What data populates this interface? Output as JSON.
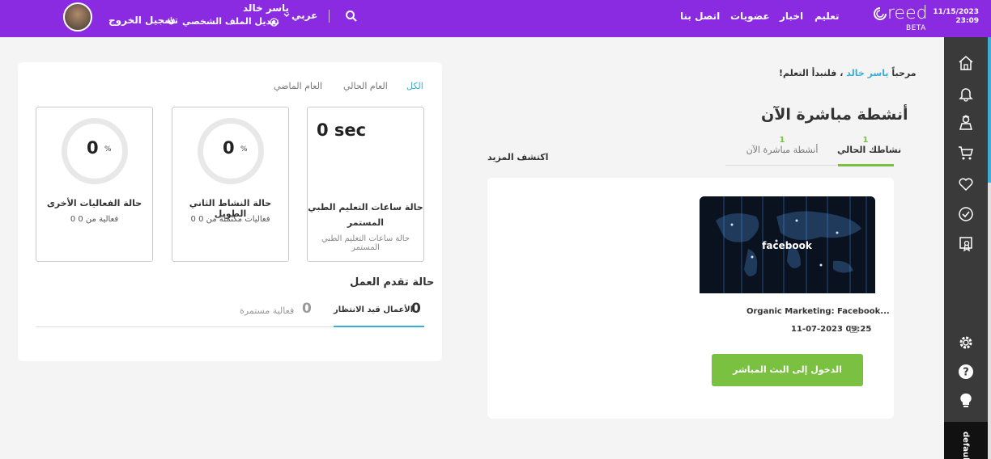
{
  "header": {
    "date": "11/15/2023",
    "time": "23:09",
    "logo_text": "reed",
    "logo_beta": "BETA",
    "nav": [
      "تعليم",
      "اخبار",
      "عضويات",
      "اتصل بنا"
    ],
    "language": "عربي",
    "user_name": "ياسر خالد",
    "edit_profile": "تعديل الملف الشخصي",
    "logout": "تسجيل الخروج",
    "thumbnail_brand": "facebook"
  },
  "colors": {
    "brand_purple": "#8a2be2",
    "accent_teal": "#3aaed8",
    "accent_green": "#7ac142",
    "sidebar_dark": "#3a3a3a"
  },
  "sidebar": {
    "icons": [
      "home-icon",
      "bell-icon",
      "teacher-icon",
      "cart-icon",
      "heart-icon",
      "badge-check-icon",
      "certificate-icon",
      "gear-icon",
      "help-icon",
      "lightbulb-icon"
    ],
    "tab_label": "default"
  },
  "welcome": {
    "prefix": "مرحباً",
    "name": "ياسر خالد",
    "suffix": "، فلنبدأ التعلم!"
  },
  "live": {
    "title": "أنشطة مباشرة الآن",
    "tabs": [
      {
        "label": "نشاطك الحالي",
        "count": "1"
      },
      {
        "label": "أنشطة مباشرة الآن",
        "count": "1"
      }
    ],
    "discover_more": "اكتشف المزيد",
    "course_title": "Organic Marketing: Facebook...",
    "course_date": "11-07-2023 09:25",
    "enter_button": "الدخول إلى البث المباشر"
  },
  "stats": {
    "filters": [
      "الكل",
      "العام الحالي",
      "العام الماضي"
    ],
    "cards": [
      {
        "value": "0 sec",
        "title_line1": "حالة ساعات التعليم الطبي",
        "title_line2": "المستمر",
        "sub_line1": "حالة ساعات التعليم الطبي",
        "sub_line2": "المستمر"
      },
      {
        "value": "0",
        "unit": "%",
        "title": "حالة النشاط الثاني الطويل",
        "sub": "0 فعاليات مكتملة من 0"
      },
      {
        "value": "0",
        "unit": "%",
        "title": "حالة الفعاليات الأخرى",
        "sub": "0 فعالية من 0"
      }
    ],
    "progress_title": "حالة تقدم العمل",
    "progress_tabs": [
      {
        "count": "0",
        "label": "الأعمال قيد الانتظار"
      },
      {
        "count": "0",
        "label": "فعالية مستمرة"
      }
    ]
  }
}
